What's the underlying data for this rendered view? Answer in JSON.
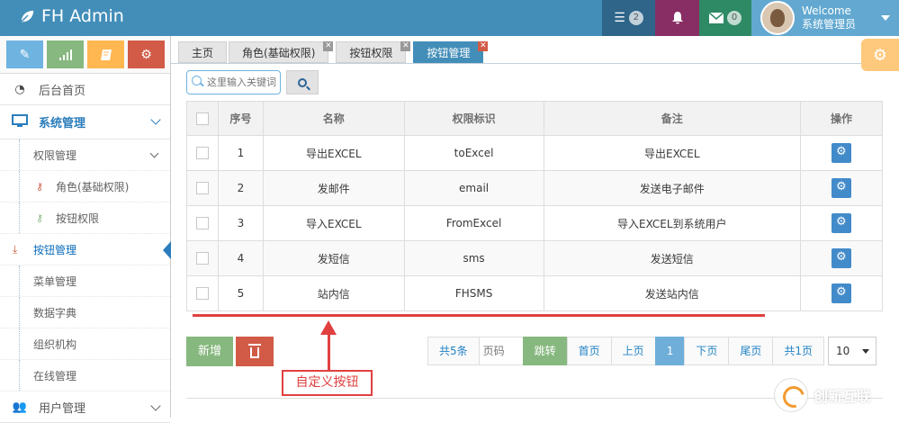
{
  "navbar": {
    "brand": "FH Admin",
    "tasks_badge": "2",
    "messages_badge": "0",
    "welcome": "Welcome",
    "username": "系统管理员"
  },
  "sidebar": {
    "items": [
      {
        "label": "后台首页"
      },
      {
        "label": "系统管理"
      },
      {
        "label": "权限管理"
      },
      {
        "label": "角色(基础权限)"
      },
      {
        "label": "按钮权限"
      },
      {
        "label": "按钮管理"
      },
      {
        "label": "菜单管理"
      },
      {
        "label": "数据字典"
      },
      {
        "label": "组织机构"
      },
      {
        "label": "在线管理"
      },
      {
        "label": "用户管理"
      }
    ]
  },
  "tabs": [
    {
      "label": "主页"
    },
    {
      "label": "角色(基础权限)"
    },
    {
      "label": "按钮权限"
    },
    {
      "label": "按钮管理"
    }
  ],
  "search": {
    "placeholder": "这里输入关键词"
  },
  "table": {
    "headers": [
      "序号",
      "名称",
      "权限标识",
      "备注",
      "操作"
    ],
    "rows": [
      {
        "no": "1",
        "name": "导出EXCEL",
        "code": "toExcel",
        "remark": "导出EXCEL"
      },
      {
        "no": "2",
        "name": "发邮件",
        "code": "email",
        "remark": "发送电子邮件"
      },
      {
        "no": "3",
        "name": "导入EXCEL",
        "code": "FromExcel",
        "remark": "导入EXCEL到系统用户"
      },
      {
        "no": "4",
        "name": "发短信",
        "code": "sms",
        "remark": "发送短信"
      },
      {
        "no": "5",
        "name": "站内信",
        "code": "FHSMS",
        "remark": "发送站内信"
      }
    ]
  },
  "buttons": {
    "add": "新增"
  },
  "pager": {
    "total": "共5条",
    "page_placeholder": "页码",
    "jump": "跳转",
    "first": "首页",
    "prev": "上页",
    "current": "1",
    "next": "下页",
    "last": "尾页",
    "pages": "共1页",
    "page_size": "10"
  },
  "annotation": "自定义按钮",
  "watermark": "创新互联",
  "colors": {
    "navbar": "#438eb9",
    "add_button": "#87b87f",
    "delete_button": "#d15b47",
    "annotation": "#e04040"
  }
}
